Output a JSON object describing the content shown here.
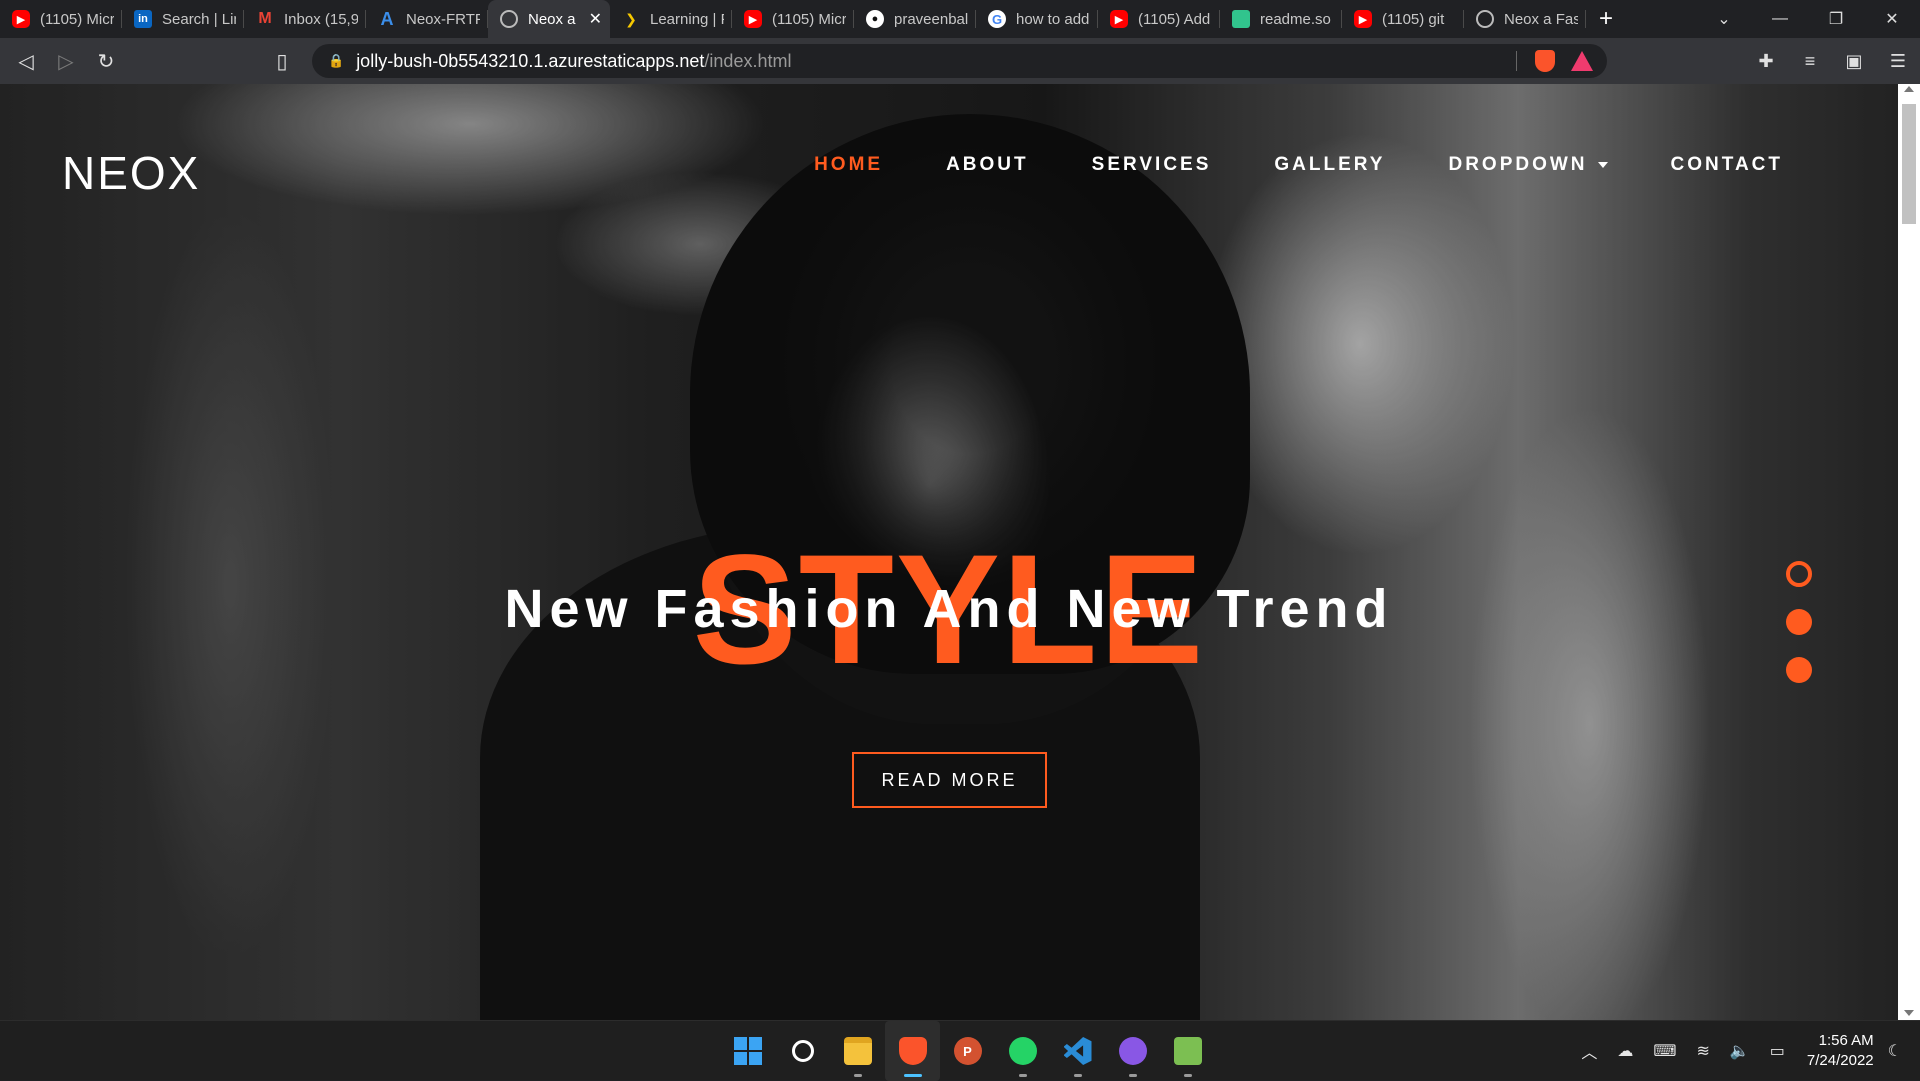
{
  "browser": {
    "tabs": [
      {
        "favicon": "youtube-icon",
        "label": "(1105) Micr",
        "active": false
      },
      {
        "favicon": "linkedin-icon",
        "label": "Search | Lin",
        "active": false
      },
      {
        "favicon": "gmail-icon",
        "label": "Inbox (15,9",
        "active": false
      },
      {
        "favicon": "azure-icon",
        "label": "Neox-FRTP",
        "active": false
      },
      {
        "favicon": "globe-icon",
        "label": "Neox a",
        "active": true
      },
      {
        "favicon": "learning-icon",
        "label": "Learning | F",
        "active": false
      },
      {
        "favicon": "youtube-icon",
        "label": "(1105) Micr",
        "active": false
      },
      {
        "favicon": "github-icon",
        "label": "praveenbal",
        "active": false
      },
      {
        "favicon": "google-icon",
        "label": "how to add",
        "active": false
      },
      {
        "favicon": "youtube-icon",
        "label": "(1105) Add",
        "active": false
      },
      {
        "favicon": "readme-icon",
        "label": "readme.so",
        "active": false
      },
      {
        "favicon": "youtube-icon",
        "label": "(1105) git",
        "active": false
      },
      {
        "favicon": "globe-icon",
        "label": "Neox a Fasl",
        "active": false
      }
    ],
    "url_host": "jolly-bush-0b5543210.1.azurestaticapps.net",
    "url_path": "/index.html"
  },
  "site": {
    "logo": "NEOX",
    "nav": {
      "home": "HOME",
      "about": "ABOUT",
      "services": "SERVICES",
      "gallery": "GALLERY",
      "dropdown": "DROPDOWN",
      "contact": "CONTACT"
    },
    "hero": {
      "background_word": "STYLE",
      "title": "New Fashion And New Trend",
      "button": "READ MORE"
    },
    "slider_dots": 3,
    "accent_color": "#ff5b1f"
  },
  "taskbar": {
    "time": "1:56 AM",
    "date": "7/24/2022"
  }
}
